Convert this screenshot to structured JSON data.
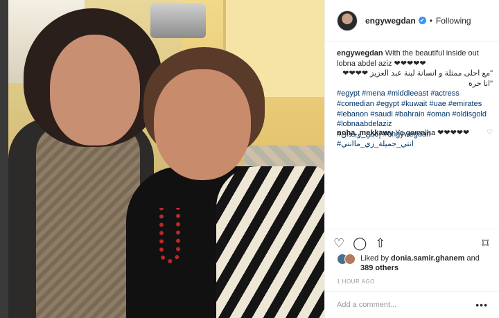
{
  "header": {
    "username": "engywegdan",
    "verified_symbol": "✔",
    "separator": "•",
    "follow_state": "Following"
  },
  "caption": {
    "username": "engywegdan",
    "line1": "With the beautiful inside out lobna abdel aziz ❤❤❤❤❤",
    "line2": "\"مع احلى ممثلة و انسانة لبنة عبد العزيز ❤❤❤❤ \"انا حرة",
    "hashtags_row1": [
      "#egypt",
      "#mena",
      "#middleeast",
      "#actress"
    ],
    "hashtags_row2": [
      "#comedian",
      "#egypt",
      "#kuwait",
      "#uae",
      "#emirates"
    ],
    "hashtags_row3": [
      "#lebanon",
      "#saudi",
      "#bahrain",
      "#oman",
      "#oldisgold"
    ],
    "hashtags_row4": [
      "#lobnaabdelaziz"
    ],
    "hashtags_row5": [
      "#إنجي_وجدان",
      "#engywegdan",
      "#انتي_جميلة_زي_ماانتي"
    ]
  },
  "comment": {
    "username": "noha_mekkawy",
    "text": "Ya gamalha ❤❤❤❤❤",
    "like_icon": "heart-outline-icon"
  },
  "actions": {
    "like_icon": "♡",
    "comment_icon": "◯",
    "share_icon": "⇧",
    "save_icon": "⌑"
  },
  "likes": {
    "prefix": "Liked by",
    "user": "donia.samir.ghanem",
    "conj": "and",
    "others": "389 others"
  },
  "timestamp": "1 HOUR AGO",
  "add_comment": {
    "placeholder": "Add a comment...",
    "more_label": "•••"
  }
}
